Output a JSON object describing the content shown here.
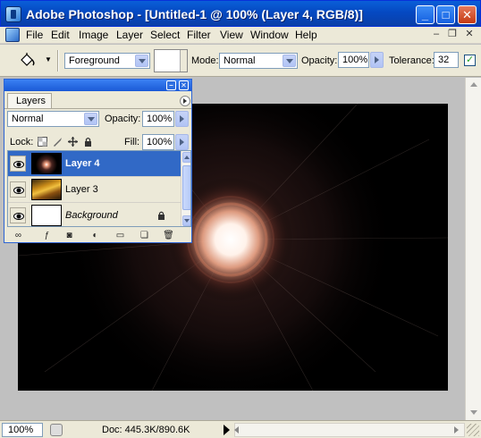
{
  "window": {
    "title": "Adobe Photoshop - [Untitled-1 @ 100% (Layer 4, RGB/8)]",
    "minimize": "_",
    "maximize": "□",
    "close": "✕"
  },
  "menu": {
    "items": [
      "File",
      "Edit",
      "Image",
      "Layer",
      "Select",
      "Filter",
      "View",
      "Window",
      "Help"
    ],
    "mdi_minimize": "–",
    "mdi_restore": "❐",
    "mdi_close": "✕"
  },
  "options": {
    "fill_source": "Foreground",
    "mode_label": "Mode:",
    "mode_value": "Normal",
    "opacity_label": "Opacity:",
    "opacity_value": "100%",
    "tolerance_label": "Tolerance:",
    "tolerance_value": "32",
    "anti_alias_checked": true
  },
  "layers_palette": {
    "tab_label": "Layers",
    "blend_mode": "Normal",
    "opacity_label": "Opacity:",
    "opacity_value": "100%",
    "lock_label": "Lock:",
    "fill_label": "Fill:",
    "fill_value": "100%",
    "layers": [
      {
        "name": "Layer 4",
        "selected": true,
        "visible": true
      },
      {
        "name": "Layer 3",
        "selected": false,
        "visible": true
      },
      {
        "name": "Background",
        "selected": false,
        "visible": true,
        "locked": true
      }
    ],
    "footer_icons": [
      "link-icon",
      "layer-style-icon",
      "layer-mask-icon",
      "adjustment-layer-icon",
      "new-group-icon",
      "new-layer-icon",
      "trash-icon"
    ]
  },
  "status": {
    "zoom": "100%",
    "doc_info": "Doc: 445.3K/890.6K"
  },
  "colors": {
    "title_bar": "#0549c2",
    "selection": "#3169c6",
    "chrome": "#ece9d8",
    "workspace": "#c0c0c0"
  }
}
